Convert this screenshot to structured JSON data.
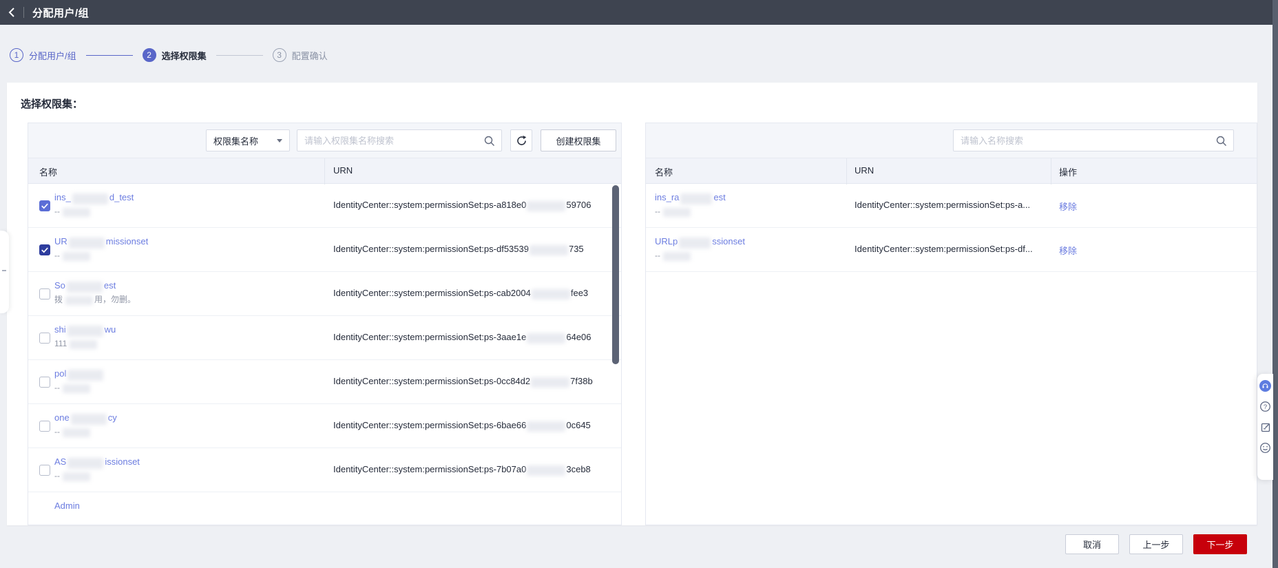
{
  "header": {
    "title": "分配用户/组"
  },
  "stepper": {
    "steps": [
      {
        "num": "1",
        "label": "分配用户/组",
        "state": "done"
      },
      {
        "num": "2",
        "label": "选择权限集",
        "state": "current"
      },
      {
        "num": "3",
        "label": "配置确认",
        "state": "pending"
      }
    ]
  },
  "main": {
    "section_title": "选择权限集："
  },
  "left_panel": {
    "filter_dropdown": {
      "value": "权限集名称"
    },
    "search": {
      "placeholder": "请输入权限集名称搜索"
    },
    "create_button": "创建权限集",
    "columns": [
      "名称",
      "URN"
    ],
    "rows": [
      {
        "checked": true,
        "checkbox_tone": "light",
        "name_prefix": "ins_",
        "name_suffix": "d_test",
        "sub_prefix": "--",
        "sub_suffix": "",
        "urn_prefix": "IdentityCenter::system:permissionSet:ps-a818e0",
        "urn_suffix": "59706"
      },
      {
        "checked": true,
        "checkbox_tone": "dark",
        "name_prefix": "UR",
        "name_suffix": "missionset",
        "sub_prefix": "--",
        "sub_suffix": "",
        "urn_prefix": "IdentityCenter::system:permissionSet:ps-df53539",
        "urn_suffix": "735"
      },
      {
        "checked": false,
        "name_prefix": "So",
        "name_suffix": "est",
        "sub_prefix": "拨",
        "sub_suffix": "用，勿删。",
        "urn_prefix": "IdentityCenter::system:permissionSet:ps-cab2004",
        "urn_suffix": "fee3"
      },
      {
        "checked": false,
        "name_prefix": "shi",
        "name_suffix": "wu",
        "sub_prefix": "111",
        "sub_suffix": "",
        "urn_prefix": "IdentityCenter::system:permissionSet:ps-3aae1e",
        "urn_suffix": "64e06"
      },
      {
        "checked": false,
        "name_prefix": "pol",
        "name_suffix": "",
        "sub_prefix": "--",
        "sub_suffix": "",
        "urn_prefix": "IdentityCenter::system:permissionSet:ps-0cc84d2",
        "urn_suffix": "7f38b"
      },
      {
        "checked": false,
        "name_prefix": "one",
        "name_suffix": "cy",
        "sub_prefix": "--",
        "sub_suffix": "",
        "urn_prefix": "IdentityCenter::system:permissionSet:ps-6bae66",
        "urn_suffix": "0c645"
      },
      {
        "checked": false,
        "name_prefix": "AS",
        "name_suffix": "issionset",
        "sub_prefix": "--",
        "sub_suffix": "",
        "urn_prefix": "IdentityCenter::system:permissionSet:ps-7b07a0",
        "urn_suffix": "3ceb8"
      },
      {
        "checked": false,
        "name_prefix": "Admin",
        "name_suffix": "",
        "sub_prefix": "",
        "sub_suffix": "",
        "urn_prefix": "",
        "urn_suffix": ""
      }
    ]
  },
  "right_panel": {
    "search": {
      "placeholder": "请输入名称搜索"
    },
    "columns": [
      "名称",
      "URN",
      "操作"
    ],
    "rows": [
      {
        "name_prefix": "ins_ra",
        "name_suffix": "est",
        "sub": "--",
        "urn": "IdentityCenter::system:permissionSet:ps-a...",
        "action": "移除"
      },
      {
        "name_prefix": "URLp",
        "name_suffix": "ssionset",
        "sub": "--",
        "urn": "IdentityCenter::system:permissionSet:ps-df...",
        "action": "移除"
      }
    ]
  },
  "footer": {
    "cancel": "取消",
    "prev": "上一步",
    "next": "下一步"
  },
  "side_toolbar": {
    "icons": [
      "headset-icon",
      "help-icon",
      "feedback-icon",
      "smiley-icon"
    ]
  },
  "colors": {
    "accent_blue": "#5966c8",
    "link_blue": "#6b7ce0",
    "danger_red": "#c7000b",
    "header_dark": "#3e4450",
    "page_bg": "#eef0f4"
  }
}
